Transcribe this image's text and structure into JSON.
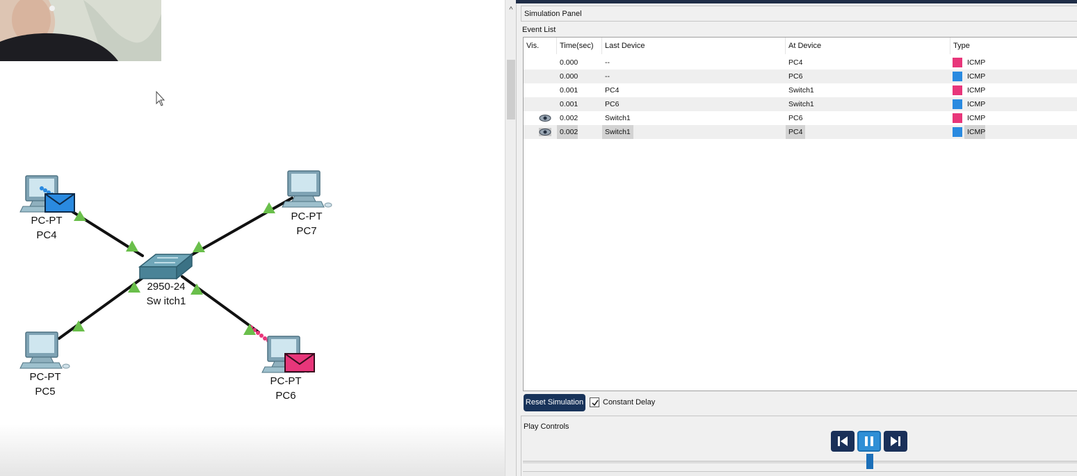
{
  "workspace": {
    "devices": [
      {
        "id": "pc4",
        "model": "PC-PT",
        "name": "PC4",
        "icon": "pc-icon"
      },
      {
        "id": "pc7",
        "model": "PC-PT",
        "name": "PC7",
        "icon": "pc-icon"
      },
      {
        "id": "pc5",
        "model": "PC-PT",
        "name": "PC5",
        "icon": "pc-icon"
      },
      {
        "id": "pc6",
        "model": "PC-PT",
        "name": "PC6",
        "icon": "pc-icon"
      },
      {
        "id": "switch1",
        "model": "2950-24",
        "name": "Sw itch1",
        "icon": "switch-icon"
      }
    ],
    "link_status_color": "#6abf4b",
    "packets": [
      {
        "at": "PC4",
        "color": "#2a8ae0",
        "icon": "envelope-icon"
      },
      {
        "at": "PC6",
        "color": "#e8367a",
        "icon": "envelope-icon"
      }
    ]
  },
  "panel": {
    "title": "Simulation Panel",
    "event_list_label": "Event List",
    "columns": [
      "Vis.",
      "Time(sec)",
      "Last Device",
      "At Device",
      "Type"
    ],
    "events": [
      {
        "vis": false,
        "time": "0.000",
        "last": "--",
        "at": "PC4",
        "color": "#e8367a",
        "type": "ICMP"
      },
      {
        "vis": false,
        "time": "0.000",
        "last": "--",
        "at": "PC6",
        "color": "#2a8ae0",
        "type": "ICMP"
      },
      {
        "vis": false,
        "time": "0.001",
        "last": "PC4",
        "at": "Switch1",
        "color": "#e8367a",
        "type": "ICMP"
      },
      {
        "vis": false,
        "time": "0.001",
        "last": "PC6",
        "at": "Switch1",
        "color": "#2a8ae0",
        "type": "ICMP"
      },
      {
        "vis": true,
        "time": "0.002",
        "last": "Switch1",
        "at": "PC6",
        "color": "#e8367a",
        "type": "ICMP"
      },
      {
        "vis": true,
        "time": "0.002",
        "last": "Switch1",
        "at": "PC4",
        "color": "#2a8ae0",
        "type": "ICMP",
        "selected": true
      }
    ],
    "reset_label": "Reset Simulation",
    "constant_delay_label": "Constant Delay",
    "constant_delay_checked": true,
    "play_controls_label": "Play Controls",
    "play_buttons": [
      "step-back-icon",
      "pause-icon",
      "step-forward-icon"
    ]
  }
}
